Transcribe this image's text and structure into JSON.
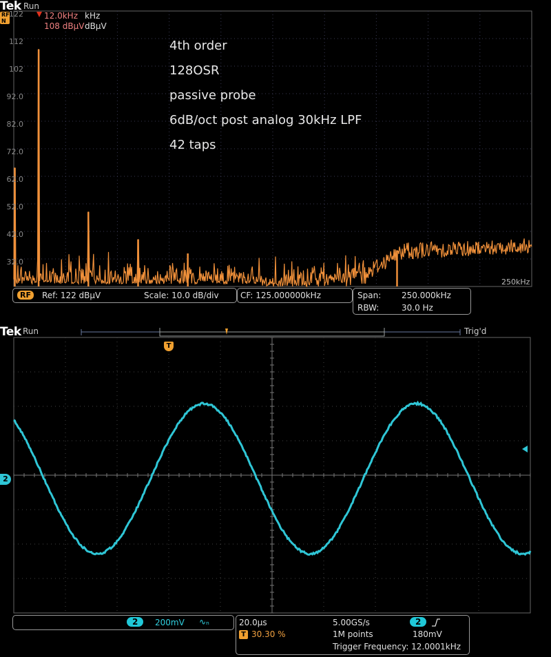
{
  "brand": "Tek",
  "status": "Run",
  "trigger_status": "Trig'd",
  "spectrum": {
    "rf_icon_letters": "RF N",
    "marker_freq": "12.0kHz",
    "marker_freq_unit": "kHz",
    "marker_level": "108 dBµV",
    "marker_level_unit": "dBµV",
    "y_ticks": [
      "122",
      "112",
      "102",
      "92.0",
      "82.0",
      "72.0",
      "62.0",
      "52.0",
      "42.0",
      "32.0"
    ],
    "span_label": "250kHz",
    "notes": [
      "4th order",
      "128OSR",
      "passive probe",
      "6dB/oct post analog 30kHz LPF",
      "42 taps"
    ],
    "ref_badge": "RF",
    "ref": "Ref: 122 dBµV",
    "scale": "Scale: 10.0 dB/div",
    "cf": "CF:  125.000000kHz",
    "span_key": "Span:",
    "span_value": "250.000kHz",
    "rbw_key": "RBW:",
    "rbw_value": "30.0 Hz",
    "colors": {
      "trace": "#f0903a",
      "grid": "#555555"
    }
  },
  "scope": {
    "channel_marker": "2",
    "trigger_marker": "T",
    "channel_badge": "2",
    "volts_div": "200mV",
    "bw_icon": "∿ₙ",
    "time_div": "20.0µs",
    "trigger_pos_badge": "T",
    "trigger_pos": "30.30 %",
    "sample_rate": "5.00GS/s",
    "record_length": "1M points",
    "trigger_channel_badge": "2",
    "trigger_slope_icon": "rising-edge-icon",
    "trigger_level": "180mV",
    "trigger_frequency": "Trigger Frequency: 12.0001kHz",
    "colors": {
      "trace": "#2fc6d6",
      "grid": "#555555"
    }
  },
  "chart_data": {
    "type": "line",
    "title": "",
    "xlabel": "",
    "ylabel": "",
    "ylim": [
      22,
      122
    ],
    "xlim": [
      0,
      250
    ],
    "peaks": [
      {
        "x": 12,
        "y": 108
      },
      {
        "x": 0.5,
        "y": 65
      },
      {
        "x": 36,
        "y": 49
      },
      {
        "x": 60,
        "y": 39
      },
      {
        "x": 84,
        "y": 34
      },
      {
        "x": 185,
        "y": 35
      }
    ],
    "noise_floor_start": 27,
    "noise_floor_end": 36
  }
}
